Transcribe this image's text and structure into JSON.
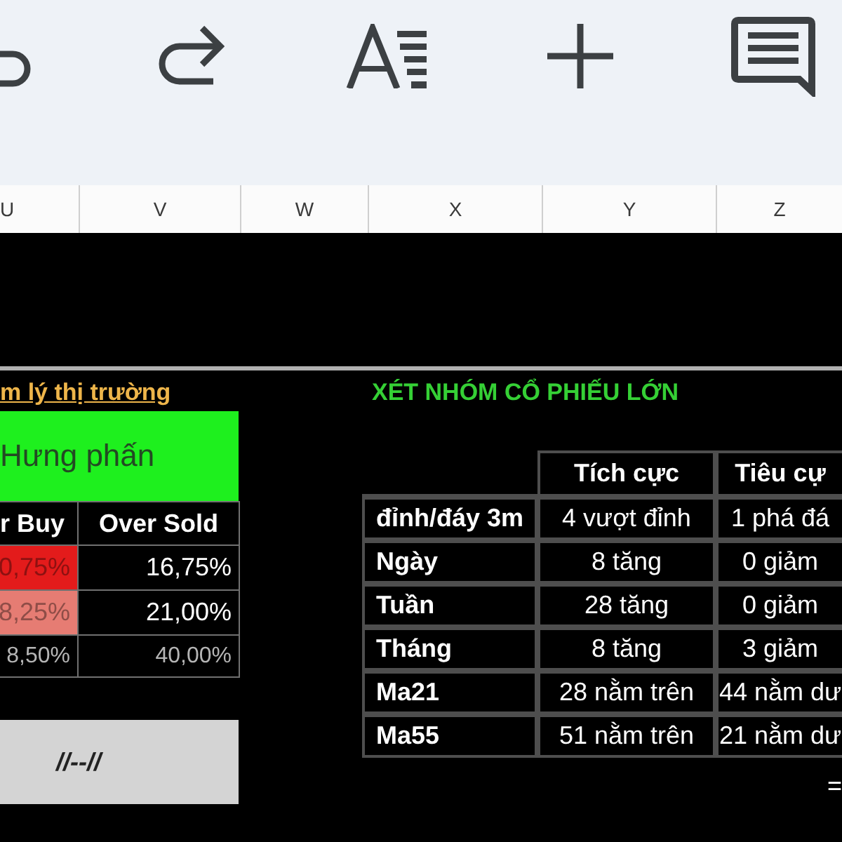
{
  "column_headers": [
    "U",
    "V",
    "W",
    "X",
    "Y",
    "Z"
  ],
  "sentiment": {
    "title": "m lý thị trường",
    "status": "Hưng phấn",
    "table": {
      "columns": [
        "r Buy",
        "Over Sold"
      ],
      "rows": [
        {
          "over_buy": "0,75%",
          "over_sold": "16,75%",
          "color": "#e31b1b",
          "dimmed": false
        },
        {
          "over_buy": "8,25%",
          "over_sold": "21,00%",
          "color": "#e67c73",
          "dimmed": false
        },
        {
          "over_buy": "8,50%",
          "over_sold": "40,00%",
          "dimmed": true
        }
      ]
    },
    "note": "//--//"
  },
  "large_caps": {
    "title": "XÉT NHÓM CỔ PHIẾU LỚN",
    "table": {
      "columns": [
        "Tích cực",
        "Tiêu cự"
      ],
      "rows": [
        {
          "label": "đỉnh/đáy 3m",
          "cells": [
            "4 vượt đỉnh",
            "1 phá đá"
          ]
        },
        {
          "label": "Ngày",
          "cells": [
            "8 tăng",
            "0 giảm"
          ]
        },
        {
          "label": "Tuần",
          "cells": [
            "28 tăng",
            "0 giảm"
          ]
        },
        {
          "label": "Tháng",
          "cells": [
            "8 tăng",
            "3 giảm"
          ]
        },
        {
          "label": "Ma21",
          "cells": [
            "28 nằm trên",
            "44 nằm dư"
          ]
        },
        {
          "label": "Ma55",
          "cells": [
            "51 nằm trên",
            "21 nằm dư"
          ]
        }
      ]
    },
    "cell_fragment": "="
  }
}
